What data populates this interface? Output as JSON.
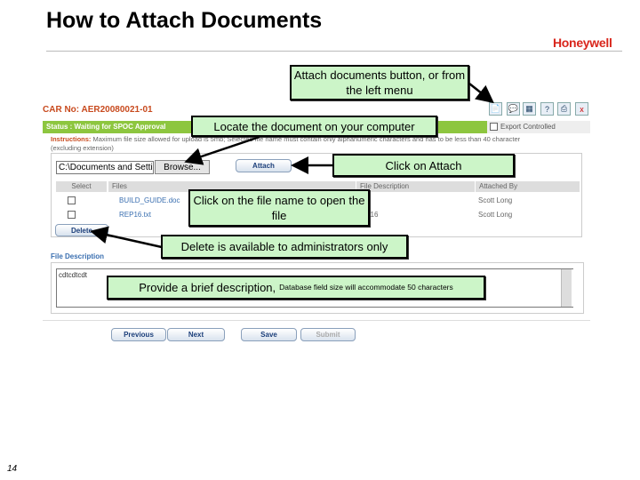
{
  "slide": {
    "title": "How to Attach Documents",
    "page_number": "14",
    "logo": "Honeywell"
  },
  "app": {
    "car_no": "CAR No: AER20080021-01",
    "status": "Status : Waiting for SPOC Approval",
    "export_controlled": "Export Controlled",
    "instructions_label": "Instructions:",
    "instructions_text": "Maximum file size allowed for upload is 5mb; Selected file name must contain only alphanumeric characters and has to be less than 40 character",
    "instructions_line2": "(excluding extension)",
    "file_path": "C:\\Documents and Setti",
    "browse_label": "Browse...",
    "attach_label": "Attach",
    "table": {
      "headers": [
        "Select",
        "Files",
        "File Description",
        "Attached By"
      ],
      "rows": [
        {
          "file": "BUILD_GUIDE.doc",
          "description": "rda",
          "attached_by": "Scott Long"
        },
        {
          "file": "REP16.txt",
          "description": "ort 16",
          "attached_by": "Scott Long"
        }
      ]
    },
    "delete_label": "Delete",
    "file_description_label": "File Description",
    "file_description_value": "cdtcdtcdt",
    "buttons": {
      "previous": "Previous",
      "next": "Next",
      "save": "Save",
      "submit": "Submit"
    },
    "toolbar_icons": [
      "attach-document-icon",
      "comment-icon",
      "report-icon",
      "help-icon",
      "print-icon",
      "close-icon"
    ],
    "status_color": "#8dc63f"
  },
  "callouts": {
    "attach_docs": "Attach documents button, or from the left menu",
    "locate": "Locate the document on your computer",
    "click_attach": "Click on Attach",
    "file_name": "Click on the file name to open the file",
    "delete": "Delete is available to administrators only",
    "describe": "Provide a brief description,",
    "describe_small": "Database field size will accommodate 50 characters"
  }
}
